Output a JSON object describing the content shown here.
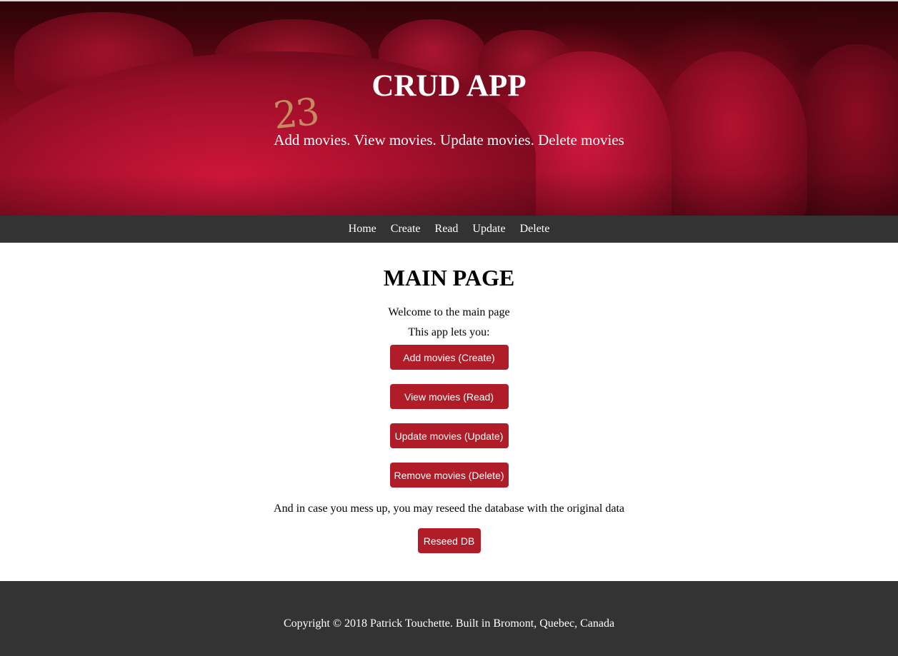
{
  "header": {
    "title": "CRUD APP",
    "subtitle": "Add movies. View movies. Update movies. Delete movies",
    "seat_number": "23"
  },
  "nav": {
    "items": [
      {
        "label": "Home"
      },
      {
        "label": "Create"
      },
      {
        "label": "Read"
      },
      {
        "label": "Update"
      },
      {
        "label": "Delete"
      }
    ]
  },
  "main": {
    "title": "MAIN PAGE",
    "welcome": "Welcome to the main page",
    "intro": "This app lets you:",
    "actions": [
      {
        "label": "Add movies (Create)"
      },
      {
        "label": "View movies (Read)"
      },
      {
        "label": "Update movies (Update)"
      },
      {
        "label": "Remove movies (Delete)"
      }
    ],
    "reseed_text": "And in case you mess up, you may reseed the database with the original data",
    "reseed_button": "Reseed DB"
  },
  "footer": {
    "copyright": "Copyright © 2018 Patrick Touchette. Built in Bromont, Quebec, Canada"
  },
  "colors": {
    "nav_bg": "#333333",
    "button_bg": "#b01c27",
    "hero_red": "#b4102a"
  }
}
